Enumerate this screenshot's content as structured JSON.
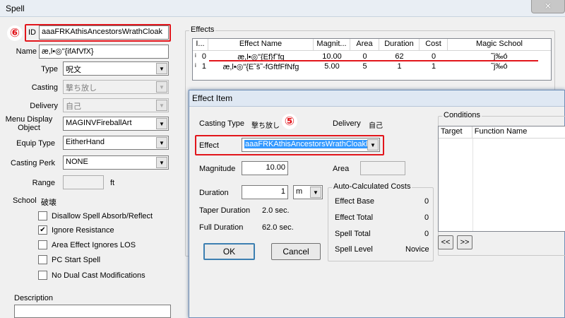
{
  "window": {
    "title": "Spell",
    "close_glyph": "✕"
  },
  "annotations": {
    "id_marker": "⑥",
    "effect_marker": "⑤"
  },
  "spell": {
    "id_label": "ID",
    "id_value": "aaaFRKAthisAncestorsWrathCloak",
    "name_label": "Name",
    "name_value": "æ,l•◎\"{ifAfVfX}",
    "type_label": "Type",
    "type_value": "呪文",
    "casting_label": "Casting",
    "casting_value": "撃ち放し",
    "delivery_label": "Delivery",
    "delivery_value": "自己",
    "menu_display_label": "Menu Display Object",
    "menu_display_value": "MAGINVFireballArt",
    "equip_type_label": "Equip Type",
    "equip_type_value": "EitherHand",
    "casting_perk_label": "Casting Perk",
    "casting_perk_value": "NONE",
    "range_label": "Range",
    "range_unit": "ft",
    "school_label": "School",
    "school_value": "破壊",
    "checkboxes": [
      {
        "label": "Disallow Spell Absorb/Reflect",
        "checked": false
      },
      {
        "label": "Ignore Resistance",
        "checked": true
      },
      {
        "label": "Area Effect Ignores LOS",
        "checked": false
      },
      {
        "label": "PC Start Spell",
        "checked": false
      },
      {
        "label": "No Dual Cast Modifications",
        "checked": false
      }
    ],
    "check_mark": "✔",
    "description_label": "Description"
  },
  "effects": {
    "group_label": "Effects",
    "columns": [
      "I...",
      "Effect Name",
      "Magnit...",
      "Area",
      "Duration",
      "Cost",
      "Magic School"
    ],
    "rows": [
      {
        "marker": "i",
        "index": "0",
        "name": "æ,l•◎\"{Ef}f˜fg",
        "magnitude": "10.00",
        "area": "0",
        "duration": "62",
        "cost": "0",
        "school": "˜j‰ó"
      },
      {
        "marker": "i",
        "index": "1",
        "name": "æ,l•◎\"{E˜š˜-fGftfFfNfg",
        "magnitude": "5.00",
        "area": "5",
        "duration": "1",
        "cost": "1",
        "school": "˜j‰ó"
      }
    ]
  },
  "effect_item": {
    "title": "Effect Item",
    "casting_type_label": "Casting Type",
    "casting_type_value": "撃ち放し",
    "delivery_label": "Delivery",
    "delivery_value": "自己",
    "effect_label": "Effect",
    "effect_value": "aaaFRKAthisAncestorsWrathCloakFF",
    "magnitude_label": "Magnitude",
    "magnitude_value": "10.00",
    "area_label": "Area",
    "duration_label": "Duration",
    "duration_value": "1",
    "duration_unit": "m",
    "taper_label": "Taper Duration",
    "taper_value": "2.0 sec.",
    "full_label": "Full Duration",
    "full_value": "62.0 sec.",
    "auto_group_label": "Auto-Calculated Costs",
    "effect_base_label": "Effect Base",
    "effect_base_value": "0",
    "effect_total_label": "Effect Total",
    "effect_total_value": "0",
    "spell_total_label": "Spell Total",
    "spell_total_value": "0",
    "spell_level_label": "Spell Level",
    "spell_level_value": "Novice",
    "ok_label": "OK",
    "cancel_label": "Cancel",
    "conditions_label": "Conditions",
    "cond_columns": [
      "Target",
      "Function Name"
    ],
    "prev_label": "<<",
    "next_label": ">>"
  },
  "colors": {
    "annotation_red": "#e2151b",
    "selection_blue": "#3399ff"
  }
}
